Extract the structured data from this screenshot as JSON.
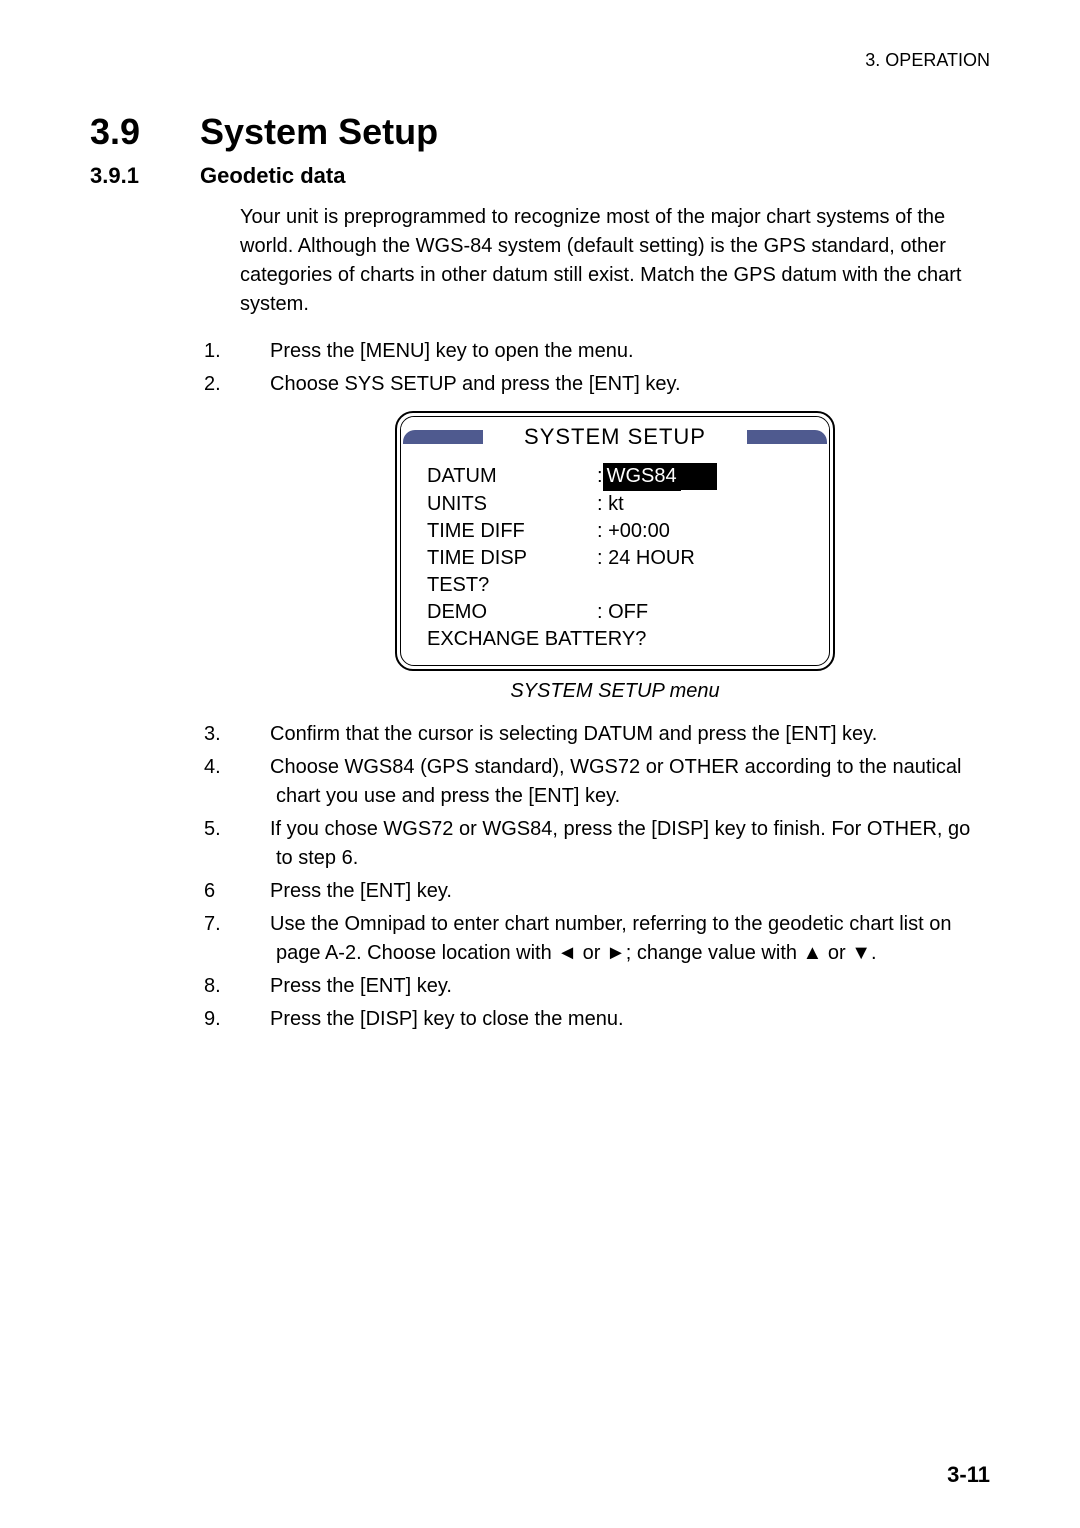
{
  "header": {
    "chapter": "3. OPERATION"
  },
  "section": {
    "num": "3.9",
    "title": "System Setup",
    "sub_num": "3.9.1",
    "sub_title": "Geodetic data",
    "intro": "Your unit is preprogrammed to recognize most of the major chart systems of the world. Although the WGS-84 system (default setting) is the GPS standard, other categories of charts in other datum still exist. Match the GPS datum with the chart system.",
    "steps_a": {
      "1": "Press the [MENU] key to open the menu.",
      "2": "Choose SYS SETUP and press the [ENT] key."
    },
    "menu": {
      "title": "SYSTEM SETUP",
      "rows": {
        "datum_label": "DATUM",
        "datum_val": "WGS84",
        "units_label": "UNITS",
        "units_val": ": kt",
        "tdiff_label": "TIME DIFF",
        "tdiff_val": ": +00:00",
        "tdisp_label": "TIME DISP",
        "tdisp_val": ": 24 HOUR",
        "test_label": "TEST?",
        "demo_label": "DEMO",
        "demo_val": ": OFF",
        "xchg_label": "EXCHANGE BATTERY?"
      },
      "caption": "SYSTEM SETUP menu"
    },
    "steps_b": {
      "3": "Confirm that the cursor is selecting DATUM and press the [ENT] key.",
      "4": "Choose WGS84 (GPS standard), WGS72 or OTHER according to the nautical chart you use and press the [ENT] key.",
      "5": "If you chose WGS72 or WGS84, press the [DISP] key to finish. For OTHER, go to step 6.",
      "6": "Press the [ENT] key.",
      "7": "Use the Omnipad to enter chart number, referring to the geodetic chart list on page A-2. Choose location with ◄ or ►; change value with ▲ or ▼.",
      "8": "Press the [ENT] key.",
      "9": "Press the [DISP] key to close the menu."
    }
  },
  "page_num": "3-11"
}
